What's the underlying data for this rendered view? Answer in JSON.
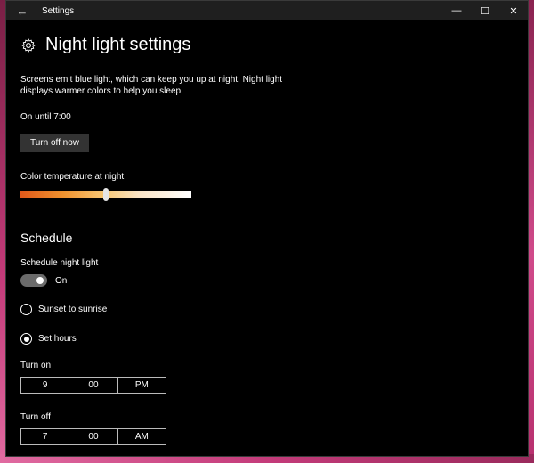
{
  "titlebar": {
    "title": "Settings"
  },
  "page": {
    "title": "Night light settings",
    "description": "Screens emit blue light, which can keep you up at night. Night light displays warmer colors to help you sleep.",
    "status": "On until 7:00",
    "turn_off_label": "Turn off now"
  },
  "color_temperature": {
    "label": "Color temperature at night",
    "level": 0.5
  },
  "schedule": {
    "heading": "Schedule",
    "toggle_label": "Schedule night light",
    "toggle_state": "On",
    "options": [
      {
        "label": "Sunset to sunrise",
        "selected": false
      },
      {
        "label": "Set hours",
        "selected": true
      }
    ],
    "turn_on": {
      "label": "Turn on",
      "hour": "9",
      "minute": "00",
      "ampm": "PM"
    },
    "turn_off": {
      "label": "Turn off",
      "hour": "7",
      "minute": "00",
      "ampm": "AM"
    }
  },
  "icons": {
    "back": "back-arrow-icon",
    "minimize": "minimize-icon",
    "maximize": "maximize-icon",
    "close": "close-icon",
    "gear": "gear-icon"
  },
  "colors": {
    "window_bg": "#000000",
    "titlebar_bg": "#1f1f1f",
    "button_bg": "#333333",
    "desktop_accent": "#b8306e"
  }
}
